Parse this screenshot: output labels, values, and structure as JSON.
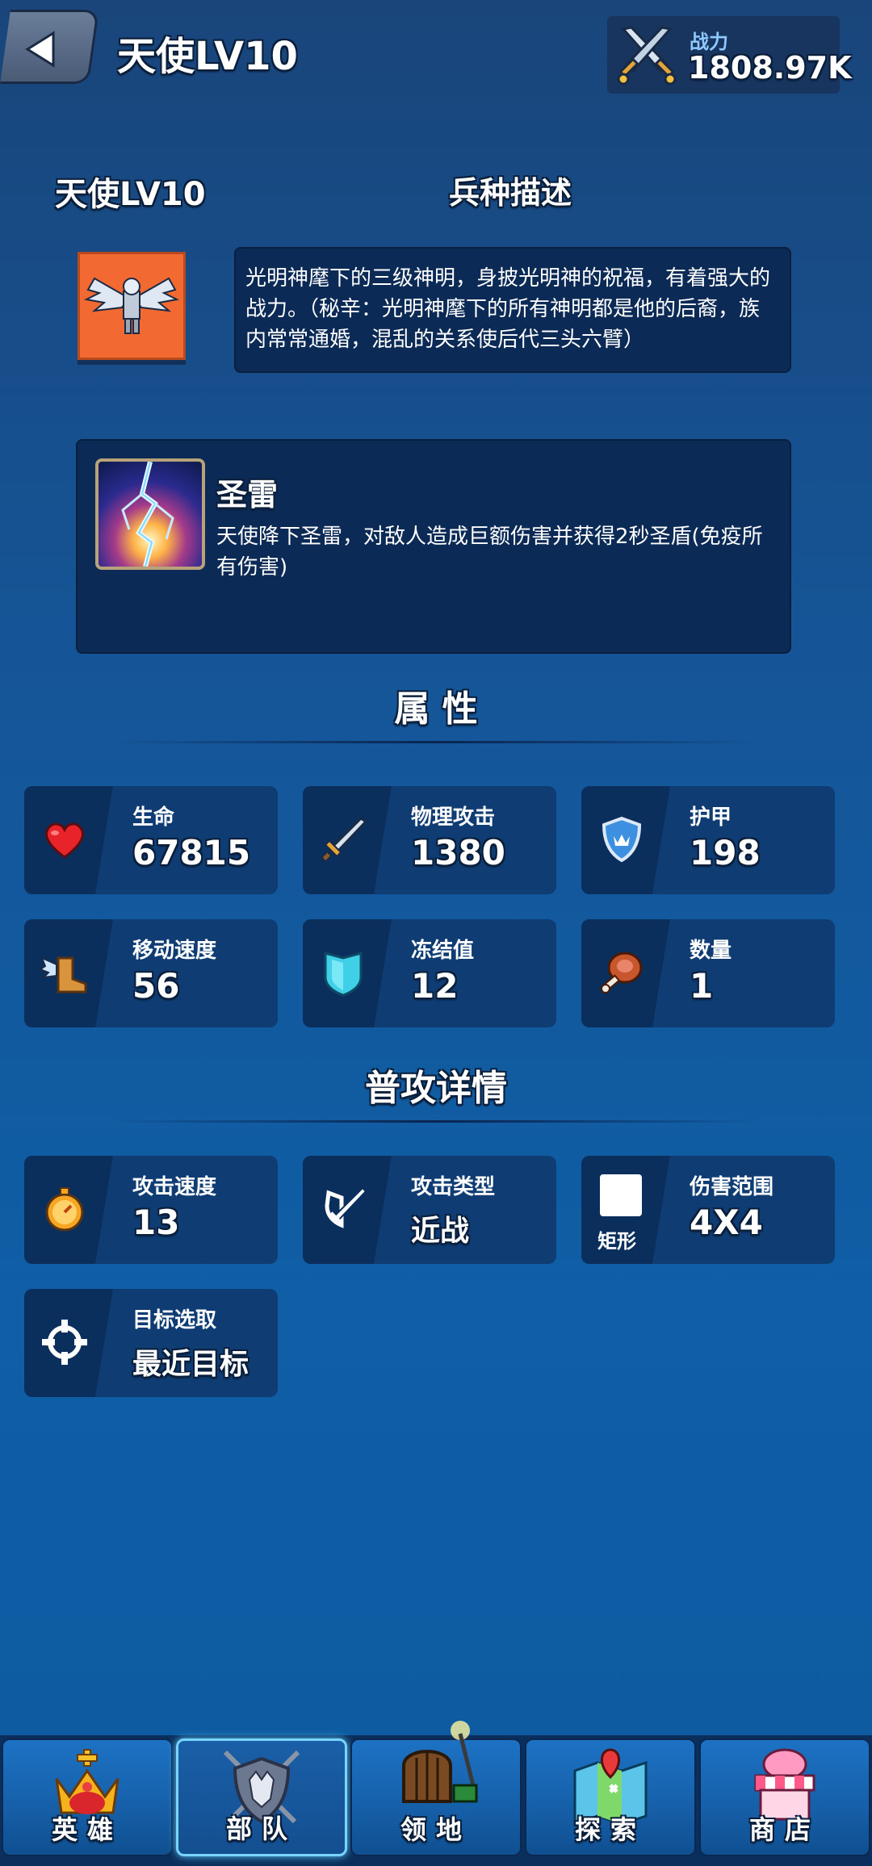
{
  "header": {
    "title": "天使LV10",
    "power_label": "战力",
    "power_value": "1808.97K"
  },
  "unit": {
    "name": "天使LV10",
    "desc_title": "兵种描述",
    "description": "光明神麾下的三级神明，身披光明神的祝福，有着强大的战力。（秘辛：光明神麾下的所有神明都是他的后裔，族内常常通婚，混乱的关系使后代三头六臂）",
    "portrait_color": "#f26a32"
  },
  "skill": {
    "name": "圣雷",
    "description": "天使降下圣雷，对敌人造成巨额伤害并获得2秒圣盾(免疫所有伤害)"
  },
  "attributes": {
    "title": "属 性",
    "items": [
      {
        "label": "生命",
        "value": "67815",
        "icon": "heart-icon"
      },
      {
        "label": "物理攻击",
        "value": "1380",
        "icon": "sword-icon"
      },
      {
        "label": "护甲",
        "value": "198",
        "icon": "shield-icon"
      },
      {
        "label": "移动速度",
        "value": "56",
        "icon": "winged-boot-icon"
      },
      {
        "label": "冻结值",
        "value": "12",
        "icon": "ice-shield-icon"
      },
      {
        "label": "数量",
        "value": "1",
        "icon": "meat-icon"
      }
    ]
  },
  "attack": {
    "title": "普攻详情",
    "items": [
      {
        "label": "攻击速度",
        "value": "13",
        "icon": "stopwatch-icon"
      },
      {
        "label": "攻击类型",
        "value": "近战",
        "icon": "melee-icon"
      },
      {
        "label": "伤害范围",
        "value": "4X4",
        "icon": "square-area-icon",
        "sub": "矩形"
      },
      {
        "label": "目标选取",
        "value": "最近目标",
        "icon": "crosshair-icon"
      }
    ]
  },
  "nav": {
    "items": [
      {
        "label": "英雄",
        "icon": "crown-icon"
      },
      {
        "label": "部队",
        "icon": "wolf-shield-icon"
      },
      {
        "label": "领地",
        "icon": "castle-gate-icon"
      },
      {
        "label": "探索",
        "icon": "map-icon"
      },
      {
        "label": "商店",
        "icon": "shop-icon"
      }
    ],
    "active": "部队"
  },
  "colors": {
    "accent": "#78d5ff",
    "power_label": "#8fc9ff",
    "card_bg": "#0f3d73",
    "panel_bg": "#0b2a55"
  }
}
